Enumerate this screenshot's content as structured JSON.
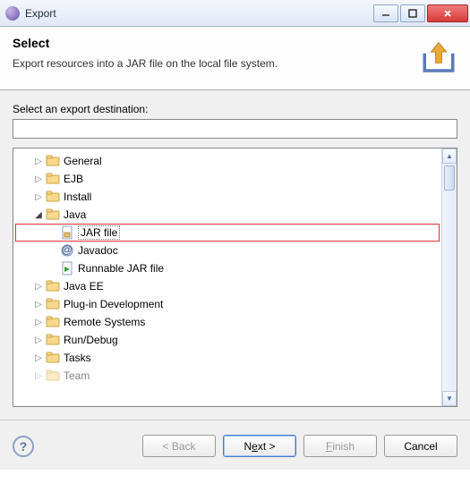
{
  "window": {
    "title": "Export"
  },
  "header": {
    "title": "Select",
    "desc": "Export resources into a JAR file on the local file system."
  },
  "filter": {
    "label": "Select an export destination:",
    "value": ""
  },
  "tree": {
    "items": [
      {
        "label": "General"
      },
      {
        "label": "EJB"
      },
      {
        "label": "Install"
      },
      {
        "label": "Java"
      },
      {
        "label": "JAR file"
      },
      {
        "label": "Javadoc"
      },
      {
        "label": "Runnable JAR file"
      },
      {
        "label": "Java EE"
      },
      {
        "label": "Plug-in Development"
      },
      {
        "label": "Remote Systems"
      },
      {
        "label": "Run/Debug"
      },
      {
        "label": "Tasks"
      },
      {
        "label": "Team"
      }
    ]
  },
  "buttons": {
    "back": "< Back",
    "next_pre": "N",
    "next_u": "e",
    "next_post": "xt >",
    "finish_pre": "",
    "finish_u": "F",
    "finish_post": "inish",
    "cancel": "Cancel"
  }
}
